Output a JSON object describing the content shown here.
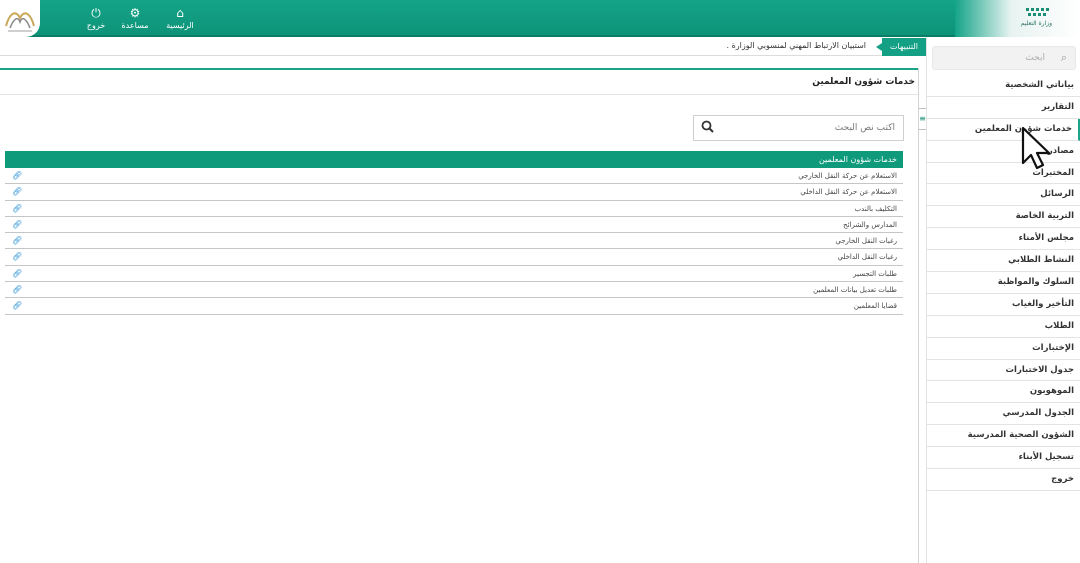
{
  "header": {
    "ministry_logo_text": "وزارة التعليم",
    "blurred_user_lines": [
      "",
      ""
    ],
    "nav": [
      {
        "label": "الرئيسية",
        "icon": "home-icon"
      },
      {
        "label": "مساعدة",
        "icon": "gear-icon"
      },
      {
        "label": "خروج",
        "icon": "power-icon"
      }
    ]
  },
  "notice": {
    "tag": "التنبيهات",
    "message": "استبيان الارتباط المهني لمنسوبي الوزارة ."
  },
  "sidebar": {
    "search_placeholder": "ابحث",
    "items": [
      {
        "label": "بياناتي الشخصية"
      },
      {
        "label": "التقارير"
      },
      {
        "label": "خدمات شؤون المعلمين"
      },
      {
        "label": "مصادر"
      },
      {
        "label": "المختبرات"
      },
      {
        "label": "الرسائل"
      },
      {
        "label": "التربية الخاصة"
      },
      {
        "label": "مجلس الأمناء"
      },
      {
        "label": "النشاط الطلابي"
      },
      {
        "label": "السلوك والمواظبة"
      },
      {
        "label": "التأخير والغياب"
      },
      {
        "label": "الطلاب"
      },
      {
        "label": "الإختبارات"
      },
      {
        "label": "جدول الاختبارات"
      },
      {
        "label": "الموهوبون"
      },
      {
        "label": "الجدول المدرسي"
      },
      {
        "label": "الشؤون الصحية المدرسية"
      },
      {
        "label": "تسجيل الأبناء"
      },
      {
        "label": "خروج"
      }
    ],
    "active_index": 2
  },
  "main": {
    "title": "خدمات شؤون المعلمين",
    "search_placeholder": "اكتب نص البحث",
    "table": {
      "header": "خدمات شؤون المعلمين",
      "rows": [
        {
          "label": "الاستعلام عن حركة النقل الخارجي"
        },
        {
          "label": "الاستعلام عن حركة النقل الداخلي"
        },
        {
          "label": "التكليف بالندب"
        },
        {
          "label": "المدارس والشرائح"
        },
        {
          "label": "رغبات النقل الخارجي"
        },
        {
          "label": "رغبات النقل الداخلي"
        },
        {
          "label": "طلبات التجسير"
        },
        {
          "label": "طلبات تعديل بيانات المعلمين"
        },
        {
          "label": "قضايا المعلمين"
        }
      ]
    }
  },
  "watermark": "",
  "colors": {
    "brand": "#14a488",
    "table_header": "#0f9a7c",
    "link": "#1d8ad3"
  }
}
